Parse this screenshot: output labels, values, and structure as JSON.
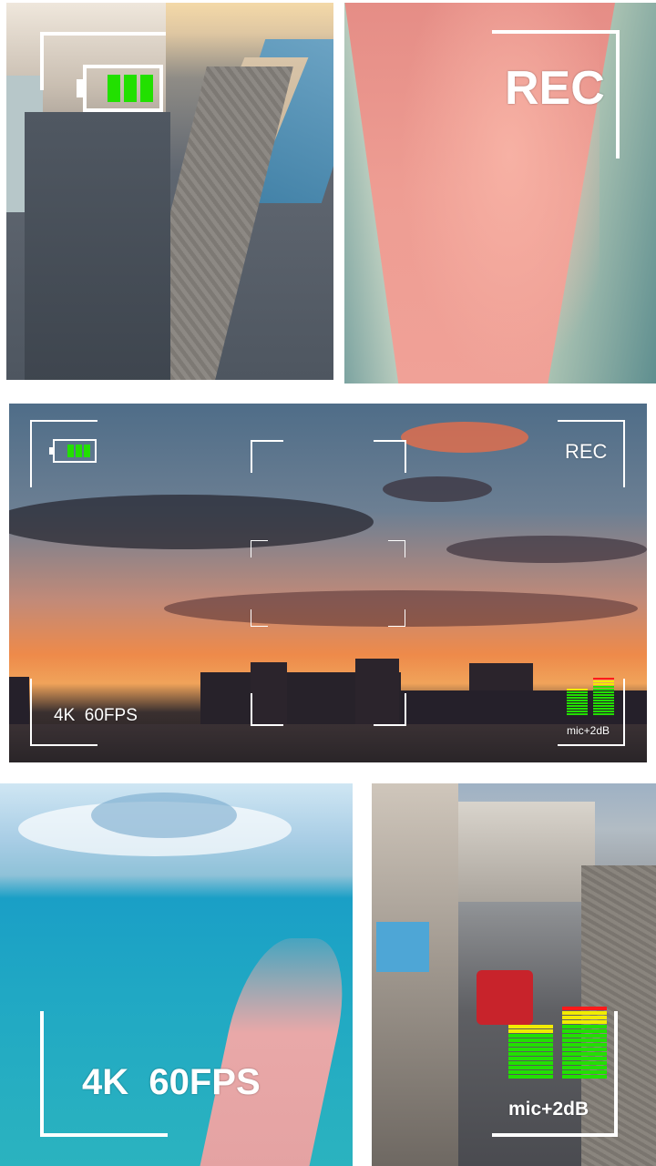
{
  "top_right": {
    "rec_label": "REC"
  },
  "middle": {
    "rec_label": "REC",
    "format_label": "4K  60FPS",
    "mic_label": "mic+2dB"
  },
  "bottom_left": {
    "format_label": "4K  60FPS"
  },
  "bottom_right": {
    "mic_label": "mic+2dB"
  },
  "colors": {
    "battery_fill": "#22e000",
    "meter_green": "#22e000",
    "meter_yellow": "#f2ec00",
    "meter_red": "#ff1a1a"
  },
  "icons": [
    "battery-icon",
    "rec-indicator",
    "audio-level-meter"
  ]
}
